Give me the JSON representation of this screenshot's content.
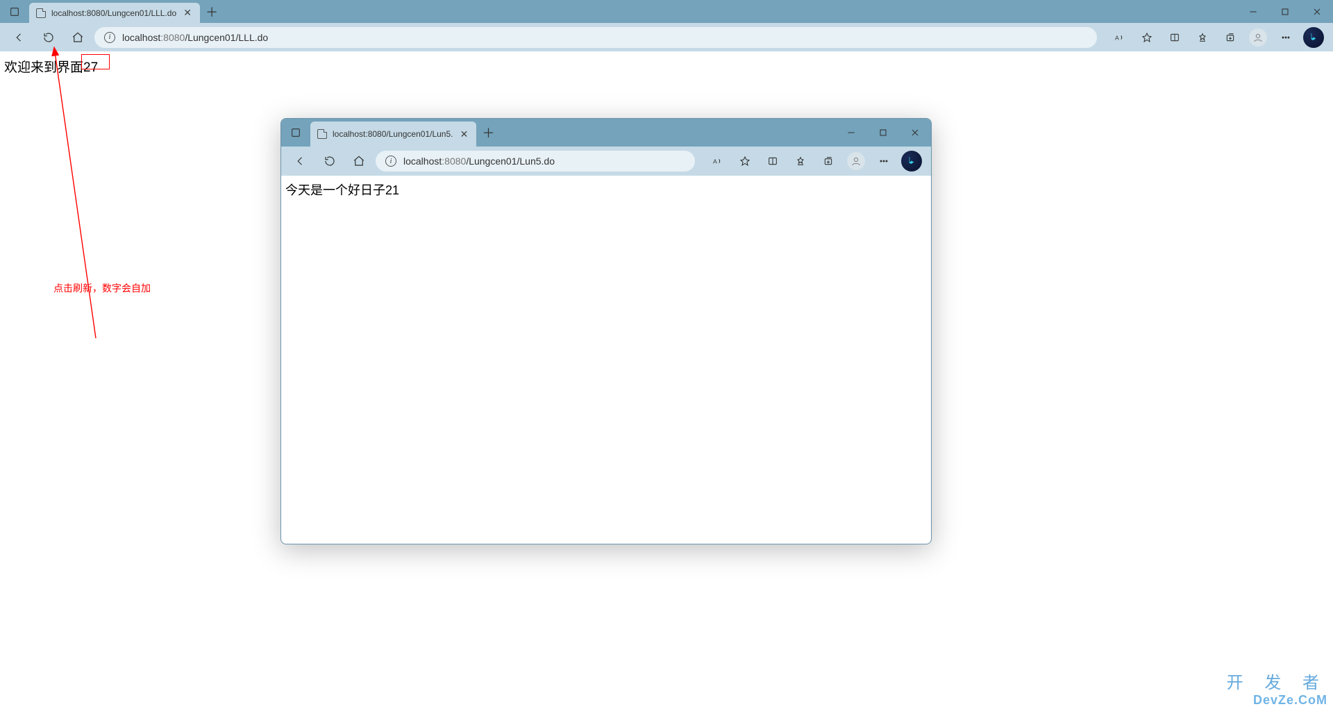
{
  "outer": {
    "tab_title": "localhost:8080/Lungcen01/LLL.do",
    "addr_host": "localhost",
    "addr_port": ":8080",
    "addr_path": "/Lungcen01/LLL.do",
    "page_text": "欢迎来到界面27"
  },
  "inner": {
    "tab_title": "localhost:8080/Lungcen01/Lun5.",
    "addr_host": "localhost",
    "addr_port": ":8080",
    "addr_path": "/Lungcen01/Lun5.do",
    "page_text": "今天是一个好日子21"
  },
  "annotation": {
    "text": "点击刷新，数字会自加"
  },
  "watermark": {
    "cn": "开 发 者",
    "en": "DevZe.CoM"
  }
}
